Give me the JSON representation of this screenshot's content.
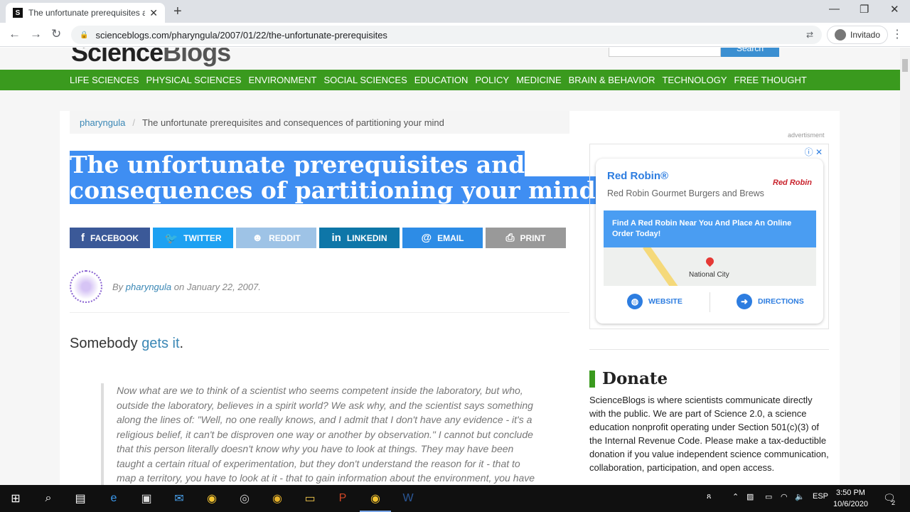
{
  "browser": {
    "tab_title": "The unfortunate prerequisites an",
    "tab_favicon": "S",
    "new_tab": "+",
    "url": "scienceblogs.com/pharyngula/2007/01/22/the-unfortunate-prerequisites",
    "profile_label": "Invitado"
  },
  "site": {
    "logo_main": "Science",
    "logo_blogs": "Blogs",
    "search_label": "Search",
    "nav": [
      "LIFE SCIENCES",
      "PHYSICAL SCIENCES",
      "ENVIRONMENT",
      "SOCIAL SCIENCES",
      "EDUCATION",
      "POLICY",
      "MEDICINE",
      "BRAIN & BEHAVIOR",
      "TECHNOLOGY",
      "FREE THOUGHT"
    ]
  },
  "article": {
    "breadcrumb_blog": "pharyngula",
    "breadcrumb_sep": "/",
    "breadcrumb_title": "The unfortunate prerequisites and consequences of partitioning your mind",
    "title_line1": "The unfortunate prerequisites and",
    "title_line2": "consequences of partitioning your mind",
    "share": {
      "facebook": "FACEBOOK",
      "twitter": "TWITTER",
      "reddit": "REDDIT",
      "linkedin": "LINKEDIN",
      "email": "EMAIL",
      "print": "PRINT"
    },
    "by_prefix": "By",
    "author": "pharyngula",
    "date_text": "on January 22, 2007.",
    "lead_text": "Somebody",
    "lead_link": "gets it",
    "lead_end": ".",
    "quote": "Now what are we to think of a scientist who seems competent inside the laboratory, but who, outside the laboratory, believes in a spirit world?  We ask why, and the scientist says something along the lines of:  \"Well, no one really knows, and I admit that I don't have any evidence - it's a religious belief, it can't be disproven one way or another by observation.\"  I cannot but conclude that this person literally doesn't know why you have to look at things.  They may have been taught a certain ritual of experimentation, but they don't understand the reason for it - that to map a territory, you have to look at it - that to gain information about the environment, you have"
  },
  "ad": {
    "label": "advertisment",
    "brand": "Red Robin®",
    "tagline": "Red Robin Gourmet Burgers and Brews",
    "logo_text": "Red Robin",
    "promo": "Find A Red Robin Near You And Place An Online Order Today!",
    "map_city": "National City",
    "website": "WEBSITE",
    "directions": "DIRECTIONS"
  },
  "sidebar": {
    "donate_title": "Donate",
    "donate_text": "ScienceBlogs is where scientists communicate directly with the public. We are part of Science 2.0, a science education nonprofit operating under Section 501(c)(3) of the Internal Revenue Code. Please make a tax-deductible donation if you value independent science communication, collaboration, participation, and open access."
  },
  "taskbar": {
    "language": "ESP",
    "time": "3:50 PM",
    "date": "10/6/2020",
    "notif_count": "2"
  },
  "colors": {
    "nav_green": "#3a9a1e",
    "selection": "#3f8ef2",
    "link": "#3a87b5",
    "facebook": "#3b5998",
    "twitter": "#1da1f2",
    "reddit": "#9ec3e6",
    "linkedin": "#0e76a8",
    "email": "#2d8ce6",
    "print": "#999999"
  }
}
